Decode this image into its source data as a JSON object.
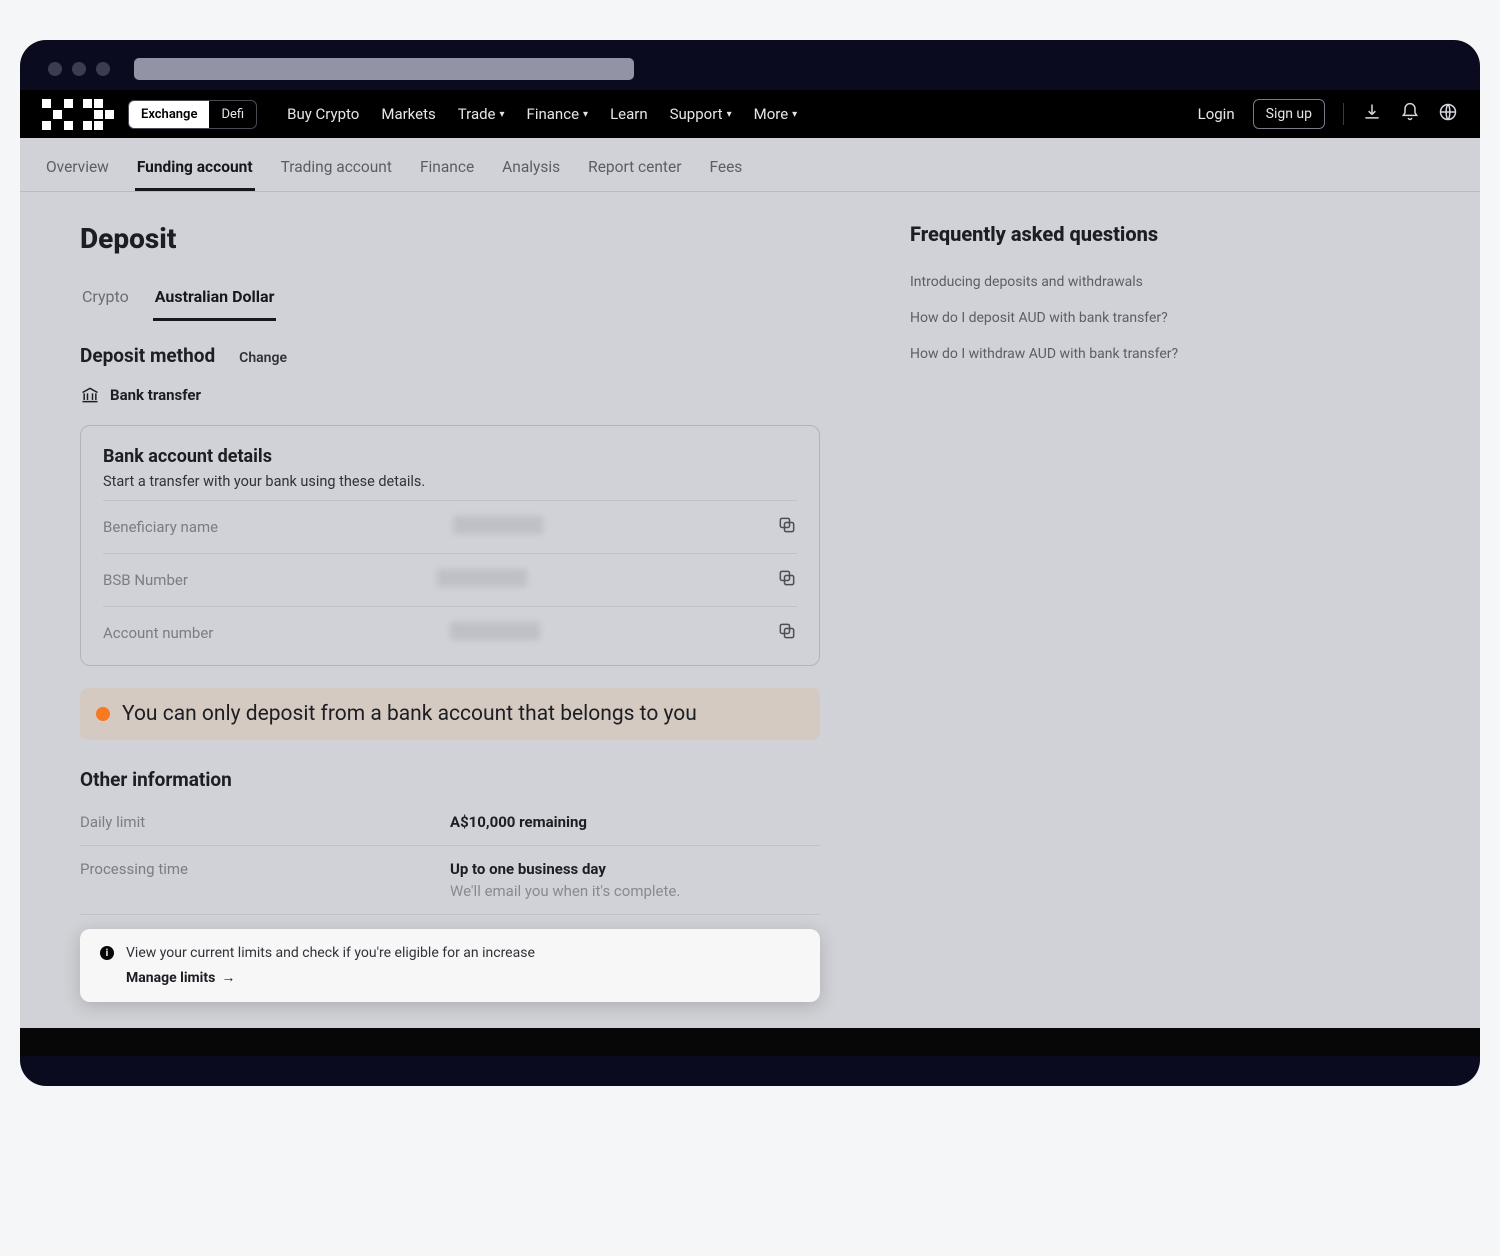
{
  "mode_toggle": {
    "exchange": "Exchange",
    "defi": "Defi"
  },
  "topnav": {
    "links": [
      "Buy Crypto",
      "Markets",
      "Trade",
      "Finance",
      "Learn",
      "Support",
      "More"
    ],
    "login": "Login",
    "signup": "Sign up"
  },
  "subtabs": [
    "Overview",
    "Funding account",
    "Trading account",
    "Finance",
    "Analysis",
    "Report center",
    "Fees"
  ],
  "page_title": "Deposit",
  "deposit_tabs": [
    "Crypto",
    "Australian Dollar"
  ],
  "method": {
    "title": "Deposit method",
    "change": "Change",
    "selected": "Bank transfer"
  },
  "details": {
    "title": "Bank account details",
    "sub": "Start a transfer with your bank using these details.",
    "rows": [
      "Beneficiary name",
      "BSB Number",
      "Account number"
    ]
  },
  "alert": "You can only deposit from a bank account that belongs to you",
  "other": {
    "title": "Other information",
    "daily_limit_label": "Daily limit",
    "daily_limit_value": "A$10,000 remaining",
    "processing_label": "Processing time",
    "processing_value": "Up to one business day",
    "processing_sub": "We'll email you when it's complete."
  },
  "limits": {
    "text": "View your current limits and check if you're eligible for an increase",
    "manage": "Manage limits"
  },
  "faq": {
    "title": "Frequently asked questions",
    "links": [
      "Introducing deposits and withdrawals",
      "How do I deposit AUD with bank transfer?",
      "How do I withdraw AUD with bank transfer?"
    ]
  }
}
